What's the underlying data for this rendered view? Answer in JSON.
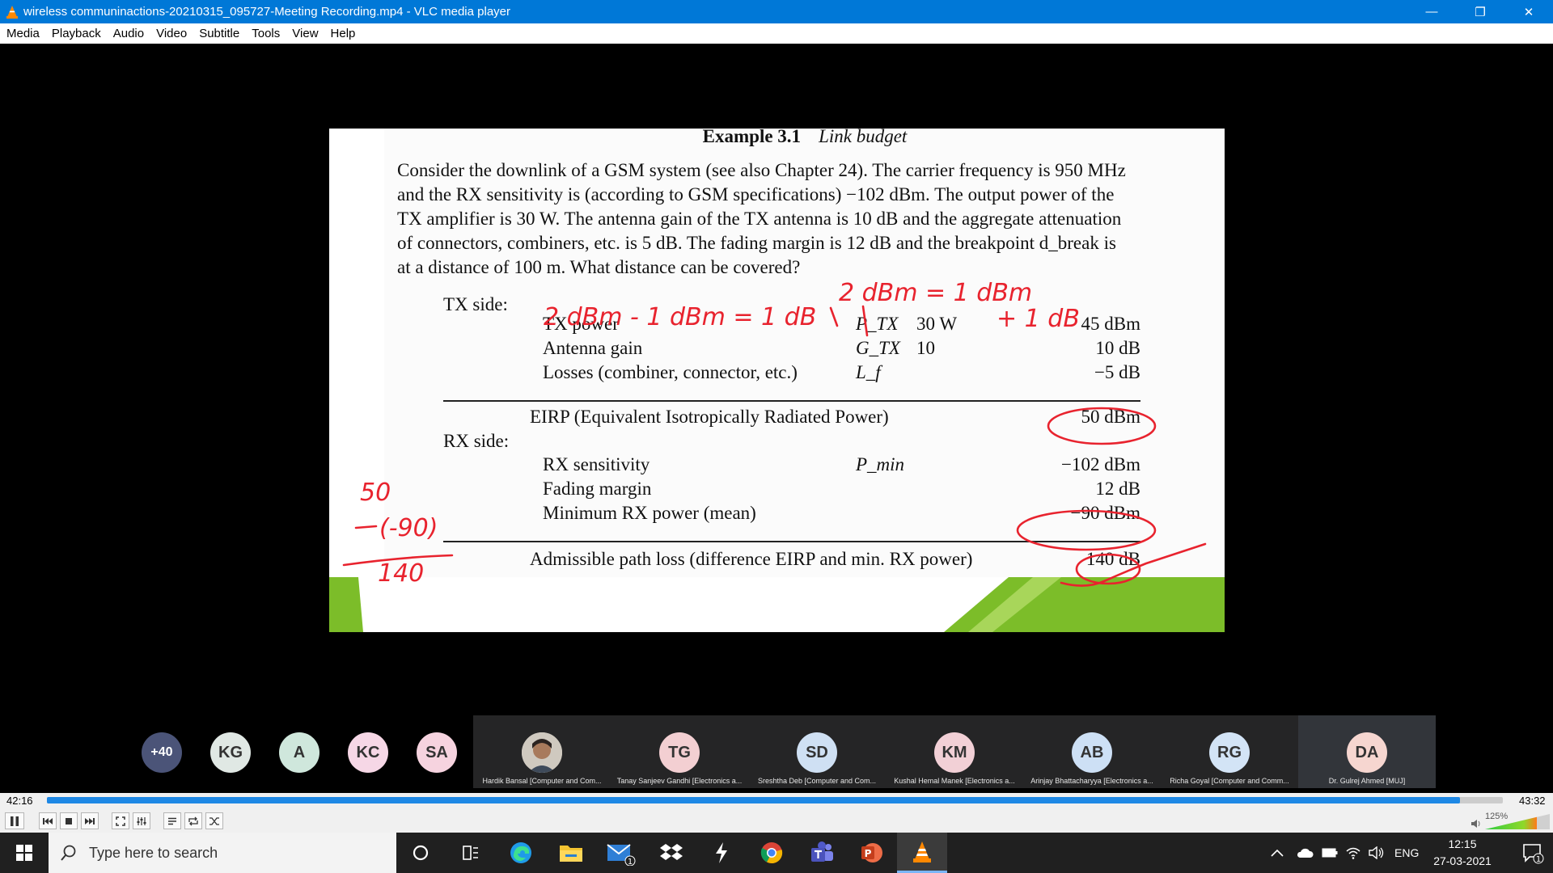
{
  "window": {
    "title": "wireless communinactions-20210315_095727-Meeting Recording.mp4 - VLC media player",
    "minimize_glyph": "—",
    "restore_glyph": "❐",
    "close_glyph": "✕"
  },
  "menu": [
    "Media",
    "Playback",
    "Audio",
    "Video",
    "Subtitle",
    "Tools",
    "View",
    "Help"
  ],
  "slide": {
    "example_number": "Example 3.1",
    "example_title": "Link budget",
    "paragraph_lines": [
      "Consider the downlink of a GSM system (see also Chapter 24). The carrier frequency is 950 MHz",
      "and the RX sensitivity is (according to GSM specifications) −102 dBm. The output power of the",
      "TX amplifier is 30 W. The antenna gain of the TX antenna is 10 dB and the aggregate attenuation",
      "of connectors, combiners, etc. is 5 dB. The fading margin is 12 dB and the breakpoint d_break is",
      "at a distance of 100 m. What distance can be covered?"
    ],
    "tx_side_label": "TX side:",
    "tx_rows": [
      {
        "label": "TX power",
        "symbol": "P_TX",
        "raw": "30 W",
        "value": "45 dBm"
      },
      {
        "label": "Antenna gain",
        "symbol": "G_TX",
        "raw": "10",
        "value": "10 dB"
      },
      {
        "label": "Losses (combiner, connector, etc.)",
        "symbol": "L_f",
        "raw": "",
        "value": "−5 dB"
      }
    ],
    "eirp": {
      "label": "EIRP (Equivalent Isotropically Radiated Power)",
      "value": "50 dBm"
    },
    "rx_side_label": "RX side:",
    "rx_rows": [
      {
        "label": "RX sensitivity",
        "symbol": "P_min",
        "value": "−102 dBm"
      },
      {
        "label": "Fading margin",
        "symbol": "",
        "value": "12 dB"
      },
      {
        "label": "Minimum RX power (mean)",
        "symbol": "",
        "value": "−90 dBm"
      }
    ],
    "path_loss": {
      "label": "Admissible path loss (difference EIRP and min. RX power)",
      "value": "140 dB"
    },
    "handwriting": {
      "top_right": "2 dBm = 1 dBm",
      "top_right_2": "+ 1 dB",
      "tx_note": "2 dBm - 1 dBm = 1 dB",
      "left_sum_top": "50",
      "left_sum_mid": "(-90)",
      "left_sum_result": "140"
    },
    "ink_color": "#e8232e",
    "band_color": "#7cbd29"
  },
  "participants": {
    "bubbles": [
      {
        "initials": "+40",
        "bg": "#4b5478",
        "fg": "#ffffff"
      },
      {
        "initials": "KG",
        "bg": "#e0e8e4",
        "fg": "#333333"
      },
      {
        "initials": "A",
        "bg": "#cfe7dc",
        "fg": "#333333"
      },
      {
        "initials": "KC",
        "bg": "#f6d7e6",
        "fg": "#333333"
      },
      {
        "initials": "SA",
        "bg": "#f6d3df",
        "fg": "#333333"
      }
    ],
    "tiles": [
      {
        "initials": "",
        "name": "Hardik Bansal [Computer and Com...",
        "bg": "#d9d4cc",
        "photo": true
      },
      {
        "initials": "TG",
        "name": "Tanay Sanjeev Gandhi [Electronics a...",
        "bg": "#f3cfd2",
        "fg": "#333333"
      },
      {
        "initials": "SD",
        "name": "Sreshtha Deb [Computer and Com...",
        "bg": "#cfe0f3",
        "fg": "#333333"
      },
      {
        "initials": "KM",
        "name": "Kushal Hemal Manek [Electronics a...",
        "bg": "#f2d0d6",
        "fg": "#333333"
      },
      {
        "initials": "AB",
        "name": "Arinjay Bhattacharyya [Electronics a...",
        "bg": "#cde0f5",
        "fg": "#333333"
      },
      {
        "initials": "RG",
        "name": "Richa Goyal [Computer and Comm...",
        "bg": "#d3e4f6",
        "fg": "#333333"
      },
      {
        "initials": "DA",
        "name": "Dr. Gulrej Ahmed [MUJ]",
        "bg": "#f6d6d0",
        "fg": "#333333"
      }
    ]
  },
  "player": {
    "elapsed": "42:16",
    "total": "43:32",
    "progress": 0.9707,
    "volume_label": "125%",
    "volume_level": 1.25
  },
  "taskbar": {
    "search_placeholder": "Type here to search",
    "mail_badge": "1",
    "language": "ENG",
    "time": "12:15",
    "date": "27-03-2021",
    "notification_count": "1"
  }
}
